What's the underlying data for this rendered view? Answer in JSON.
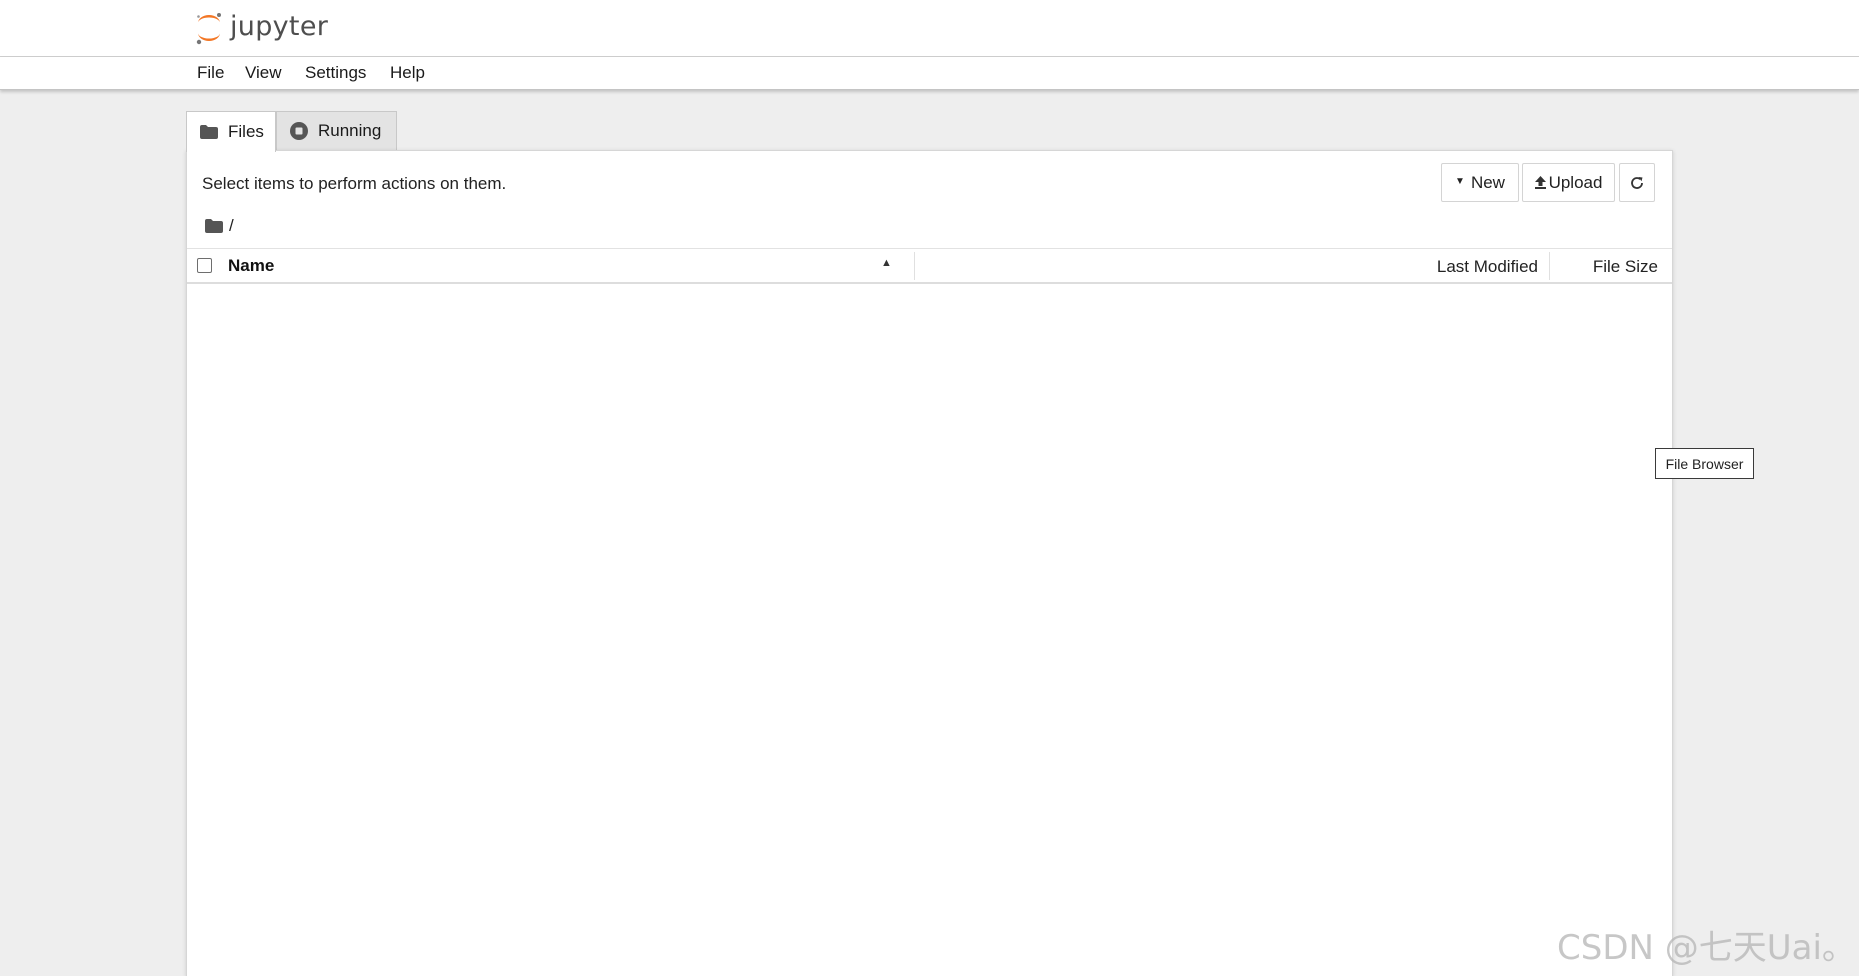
{
  "header": {
    "logo_text": "jupyter"
  },
  "menu": {
    "items": [
      "File",
      "View",
      "Settings",
      "Help"
    ]
  },
  "tabs": [
    {
      "label": "Files",
      "icon": "folder-icon",
      "active": true
    },
    {
      "label": "Running",
      "icon": "stop-circle-icon",
      "active": false
    }
  ],
  "file_browser": {
    "hint": "Select items to perform actions on them.",
    "new_label": "New",
    "upload_label": "Upload",
    "refresh_icon": "refresh-icon",
    "breadcrumb_path": "/",
    "columns": {
      "name": "Name",
      "last_modified": "Last Modified",
      "file_size": "File Size"
    },
    "sort": "name-ascending",
    "rows": []
  },
  "tooltip": {
    "text": "File Browser"
  },
  "watermark": {
    "text": "CSDN @七天Uai。"
  },
  "colors": {
    "brand_orange": "#f37726",
    "background": "#eeeeee",
    "panel": "#ffffff"
  }
}
